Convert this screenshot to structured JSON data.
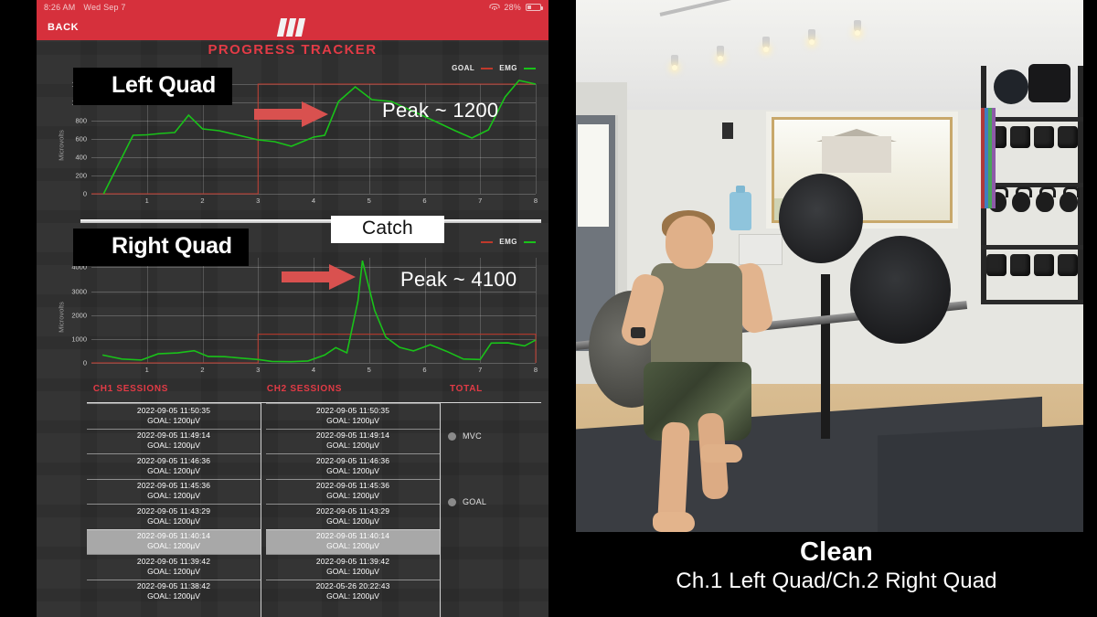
{
  "status_bar": {
    "time": "8:26 AM",
    "date": "Wed Sep 7",
    "battery_percent": "28%",
    "wifi_icon": "wifi-icon",
    "battery_icon": "battery-icon"
  },
  "nav": {
    "back_label": "BACK",
    "logo_icon": "app-logo-icon"
  },
  "app": {
    "title": "PROGRESS TRACKER"
  },
  "overlays": {
    "left_label": "Left Quad",
    "right_label": "Right Quad",
    "peak_left": "Peak ~ 1200",
    "peak_right": "Peak ~ 4100",
    "catch": "Catch",
    "arrow_icon": "red-arrow-right-icon"
  },
  "legend": {
    "goal": "GOAL",
    "emg": "EMG",
    "goal_color": "#c0392b",
    "emg_color": "#19c219"
  },
  "table": {
    "headers": [
      "CH1 SESSIONS",
      "CH2 SESSIONS",
      "TOTAL"
    ],
    "ch1": [
      {
        "timestamp": "2022-09-05 11:50:35",
        "goal": "GOAL: 1200µV",
        "selected": false
      },
      {
        "timestamp": "2022-09-05 11:49:14",
        "goal": "GOAL: 1200µV",
        "selected": false
      },
      {
        "timestamp": "2022-09-05 11:46:36",
        "goal": "GOAL: 1200µV",
        "selected": false
      },
      {
        "timestamp": "2022-09-05 11:45:36",
        "goal": "GOAL: 1200µV",
        "selected": false
      },
      {
        "timestamp": "2022-09-05 11:43:29",
        "goal": "GOAL: 1200µV",
        "selected": false
      },
      {
        "timestamp": "2022-09-05 11:40:14",
        "goal": "GOAL: 1200µV",
        "selected": true
      },
      {
        "timestamp": "2022-09-05 11:39:42",
        "goal": "GOAL: 1200µV",
        "selected": false
      },
      {
        "timestamp": "2022-09-05 11:38:42",
        "goal": "GOAL: 1200µV",
        "selected": false
      }
    ],
    "ch2": [
      {
        "timestamp": "2022-09-05 11:50:35",
        "goal": "GOAL: 1200µV",
        "selected": false
      },
      {
        "timestamp": "2022-09-05 11:49:14",
        "goal": "GOAL: 1200µV",
        "selected": false
      },
      {
        "timestamp": "2022-09-05 11:46:36",
        "goal": "GOAL: 1200µV",
        "selected": false
      },
      {
        "timestamp": "2022-09-05 11:45:36",
        "goal": "GOAL: 1200µV",
        "selected": false
      },
      {
        "timestamp": "2022-09-05 11:43:29",
        "goal": "GOAL: 1200µV",
        "selected": false
      },
      {
        "timestamp": "2022-09-05 11:40:14",
        "goal": "GOAL: 1200µV",
        "selected": true
      },
      {
        "timestamp": "2022-09-05 11:39:42",
        "goal": "GOAL: 1200µV",
        "selected": false
      },
      {
        "timestamp": "2022-05-26 20:22:43",
        "goal": "GOAL: 1200µV",
        "selected": false
      }
    ],
    "total_options": [
      {
        "label": "MVC",
        "name": "radio-mvc"
      },
      {
        "label": "GOAL",
        "name": "radio-goal"
      }
    ]
  },
  "video_caption": {
    "title": "Clean",
    "subtitle": "Ch.1 Left Quad/Ch.2 Right Quad"
  },
  "chart_data": [
    {
      "type": "line",
      "title": "Left Quad",
      "xlabel": "",
      "ylabel": "Microvolts",
      "xlim": [
        0,
        8
      ],
      "ylim": [
        0,
        1200
      ],
      "yticks": [
        0,
        200,
        400,
        600,
        800,
        1000,
        1200
      ],
      "xticks": [
        1,
        2,
        3,
        4,
        5,
        6,
        7,
        8
      ],
      "grid": true,
      "legend": [
        "GOAL",
        "EMG"
      ],
      "legend_position": "top-right",
      "annotation": "Peak ~ 1200",
      "series": [
        {
          "name": "EMG",
          "color": "#19c219",
          "x": [
            0.22,
            0.75,
            1.0,
            1.25,
            1.5,
            1.75,
            2.0,
            2.3,
            2.65,
            3.0,
            3.3,
            3.6,
            4.0,
            4.2,
            4.45,
            4.75,
            5.05,
            5.4,
            5.8,
            6.2,
            6.55,
            6.85,
            7.15,
            7.45,
            7.7,
            8.0
          ],
          "y": [
            0,
            640,
            645,
            660,
            670,
            860,
            710,
            690,
            640,
            590,
            570,
            520,
            620,
            640,
            1010,
            1170,
            1030,
            1010,
            900,
            790,
            690,
            610,
            700,
            1060,
            1240,
            1200
          ]
        },
        {
          "name": "GOAL",
          "color": "#c0392b",
          "x": [
            0.0,
            3.0,
            3.0,
            8.0
          ],
          "y": [
            0,
            0,
            1200,
            1200
          ]
        }
      ]
    },
    {
      "type": "line",
      "title": "Right Quad",
      "xlabel": "",
      "ylabel": "Microvolts",
      "xlim": [
        0,
        8
      ],
      "ylim": [
        0,
        4400
      ],
      "yticks": [
        0,
        1000,
        2000,
        3000,
        4000
      ],
      "xticks": [
        1,
        2,
        3,
        4,
        5,
        6,
        7,
        8
      ],
      "grid": true,
      "legend": [
        "GOAL",
        "EMG"
      ],
      "legend_position": "top-right",
      "annotation": "Peak ~ 4100",
      "series": [
        {
          "name": "EMG",
          "color": "#19c219",
          "x": [
            0.2,
            0.55,
            0.9,
            1.2,
            1.55,
            1.85,
            2.1,
            2.4,
            2.7,
            3.0,
            3.25,
            3.6,
            3.9,
            4.2,
            4.4,
            4.6,
            4.8,
            4.88,
            5.1,
            5.3,
            5.55,
            5.8,
            6.1,
            6.4,
            6.7,
            7.0,
            7.2,
            7.5,
            7.8,
            8.0
          ],
          "y": [
            330,
            160,
            120,
            380,
            420,
            510,
            270,
            260,
            200,
            140,
            60,
            50,
            80,
            330,
            640,
            420,
            2600,
            4280,
            2200,
            1080,
            650,
            500,
            760,
            480,
            160,
            140,
            830,
            840,
            710,
            960
          ]
        },
        {
          "name": "GOAL",
          "color": "#c0392b",
          "x": [
            0.0,
            3.0,
            3.0,
            8.0,
            8.0
          ],
          "y": [
            0,
            0,
            1200,
            1200,
            0
          ]
        }
      ]
    }
  ]
}
